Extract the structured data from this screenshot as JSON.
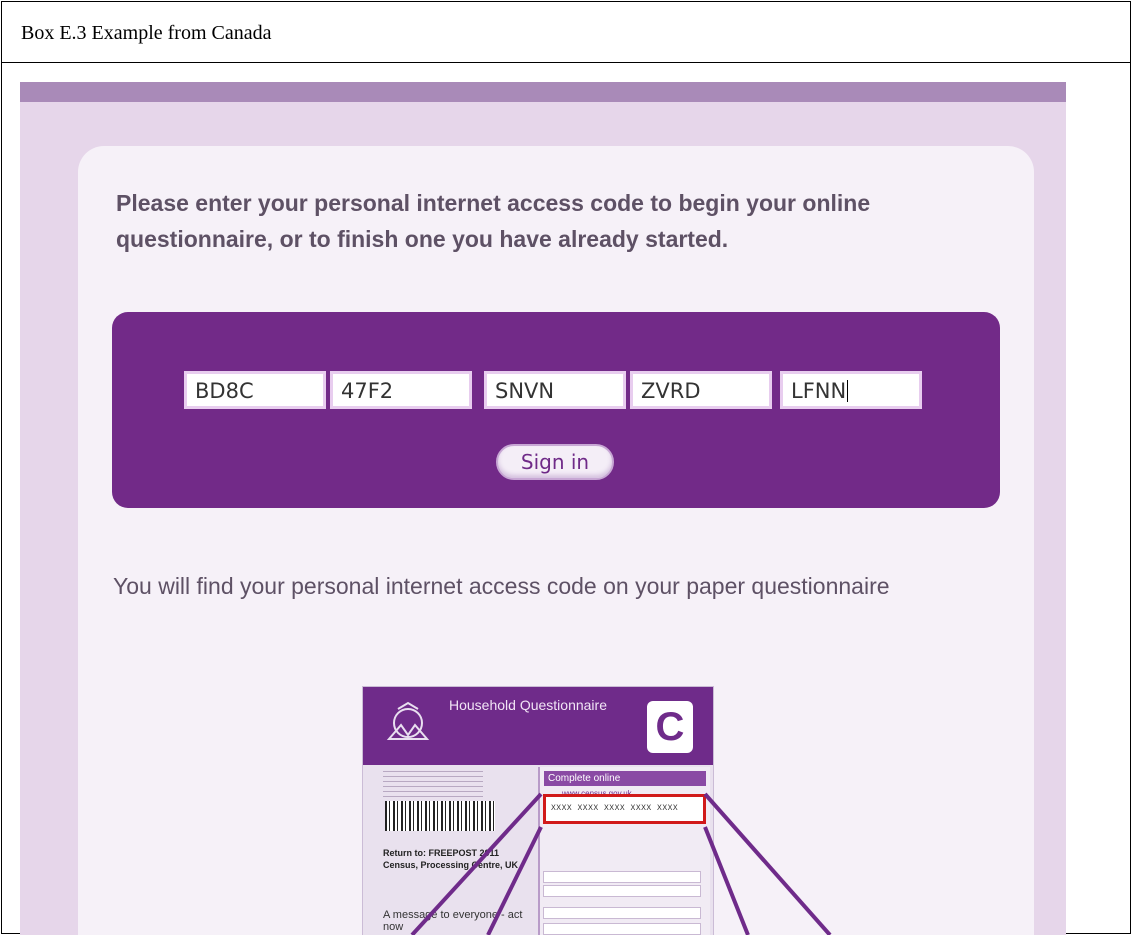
{
  "caption": "Box E.3 Example from Canada",
  "heading": "Please enter your personal internet access code to begin your online questionnaire, or to finish one you have already started.",
  "code_fields": [
    "BD8C",
    "47F2",
    "SNVN",
    "ZVRD",
    "LFNN"
  ],
  "sign_in_label": "Sign in",
  "note": "You will find your personal internet access code on your paper questionnaire",
  "paper": {
    "title": "Household Questionnaire",
    "logo_letter": "C",
    "complete_online": "Complete online",
    "website": "www.census.gov.uk",
    "code_mask": "XXXX XXXX XXXX XXXX XXXX",
    "return_to": "Return to: FREEPOST 2011 Census, Processing Centre, UK",
    "message": "A message to everyone - act now"
  },
  "colors": {
    "frame_background": "#e6d6ea",
    "code_panel": "#722a88",
    "text": "#5e5165",
    "highlight": "#d11a1a"
  }
}
